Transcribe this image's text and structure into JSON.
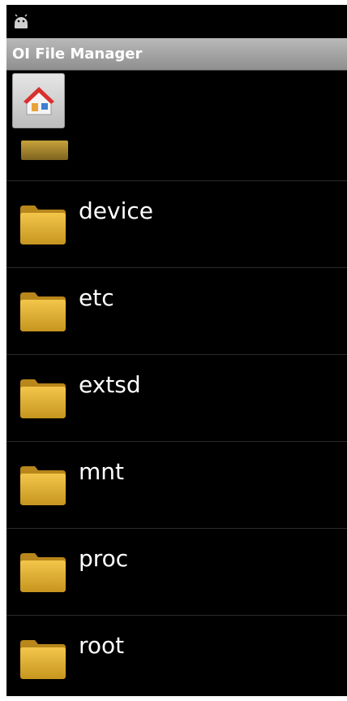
{
  "status_bar": {
    "icon": "android-icon"
  },
  "header": {
    "title": "OI File Manager"
  },
  "toolbar": {
    "home_icon": "home-icon"
  },
  "colors": {
    "background": "#000000",
    "titlebar": "#a8a8a8",
    "folder": "#e0b03a"
  },
  "files": [
    {
      "name": "device",
      "icon": "folder-icon"
    },
    {
      "name": "etc",
      "icon": "folder-icon"
    },
    {
      "name": "extsd",
      "icon": "folder-icon"
    },
    {
      "name": "mnt",
      "icon": "folder-icon"
    },
    {
      "name": "proc",
      "icon": "folder-icon"
    },
    {
      "name": "root",
      "icon": "folder-icon"
    }
  ]
}
